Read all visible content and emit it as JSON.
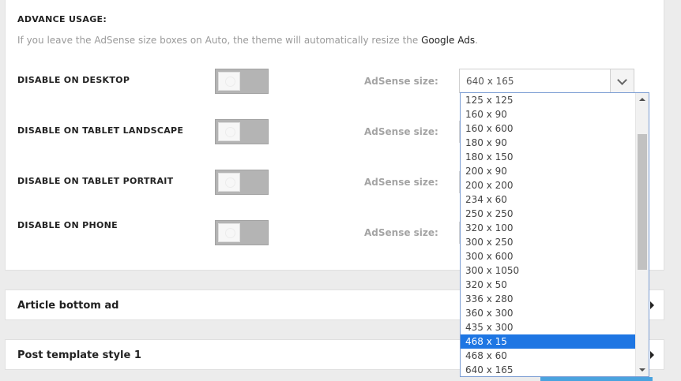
{
  "advance_usage": {
    "title": "ADVANCE USAGE:",
    "help_prefix": "If you leave the AdSense size boxes on Auto, the theme will automatically resize the ",
    "help_link": "Google Ads",
    "help_suffix": "."
  },
  "rows": [
    {
      "label": "DISABLE ON DESKTOP",
      "toggle_on": false,
      "size_label": "AdSense size:"
    },
    {
      "label": "DISABLE ON TABLET LANDSCAPE",
      "toggle_on": false,
      "size_label": "AdSense size:"
    },
    {
      "label": "DISABLE ON TABLET PORTRAIT",
      "toggle_on": false,
      "size_label": "AdSense size:"
    },
    {
      "label": "DISABLE ON PHONE",
      "toggle_on": false,
      "size_label": "AdSense size:"
    }
  ],
  "adsense_select": {
    "value": "640 x 165",
    "highlighted": "468 x 15",
    "options": [
      "125 x 125",
      "160 x 90",
      "160 x 600",
      "180 x 90",
      "180 x 150",
      "200 x 90",
      "200 x 200",
      "234 x 60",
      "250 x 250",
      "320 x 100",
      "300 x 250",
      "300 x 600",
      "300 x 1050",
      "320 x 50",
      "336 x 280",
      "360 x 300",
      "435 x 300",
      "468 x 15",
      "468 x 60",
      "640 x 165"
    ]
  },
  "cards": [
    {
      "title": "Article bottom ad"
    },
    {
      "title": "Post template style 1"
    }
  ],
  "colors": {
    "highlight": "#1e76e3",
    "toggle_off": "#b4b4b4",
    "page_background": "#ececec"
  }
}
